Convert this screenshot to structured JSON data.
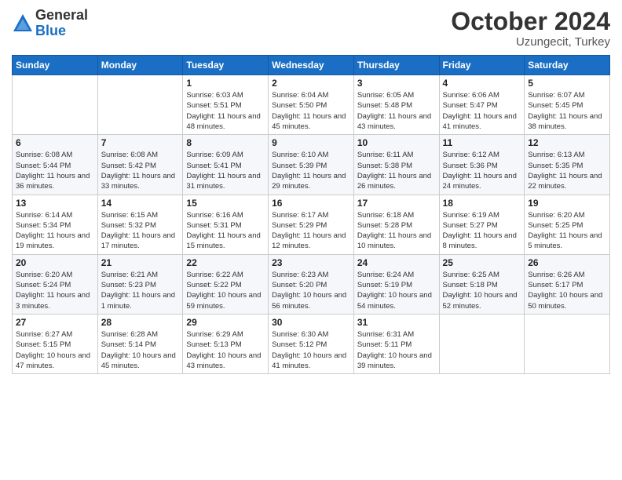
{
  "header": {
    "logo_general": "General",
    "logo_blue": "Blue",
    "month": "October 2024",
    "location": "Uzungecit, Turkey"
  },
  "weekdays": [
    "Sunday",
    "Monday",
    "Tuesday",
    "Wednesday",
    "Thursday",
    "Friday",
    "Saturday"
  ],
  "weeks": [
    [
      {
        "day": "",
        "sunrise": "",
        "sunset": "",
        "daylight": ""
      },
      {
        "day": "",
        "sunrise": "",
        "sunset": "",
        "daylight": ""
      },
      {
        "day": "1",
        "sunrise": "Sunrise: 6:03 AM",
        "sunset": "Sunset: 5:51 PM",
        "daylight": "Daylight: 11 hours and 48 minutes."
      },
      {
        "day": "2",
        "sunrise": "Sunrise: 6:04 AM",
        "sunset": "Sunset: 5:50 PM",
        "daylight": "Daylight: 11 hours and 45 minutes."
      },
      {
        "day": "3",
        "sunrise": "Sunrise: 6:05 AM",
        "sunset": "Sunset: 5:48 PM",
        "daylight": "Daylight: 11 hours and 43 minutes."
      },
      {
        "day": "4",
        "sunrise": "Sunrise: 6:06 AM",
        "sunset": "Sunset: 5:47 PM",
        "daylight": "Daylight: 11 hours and 41 minutes."
      },
      {
        "day": "5",
        "sunrise": "Sunrise: 6:07 AM",
        "sunset": "Sunset: 5:45 PM",
        "daylight": "Daylight: 11 hours and 38 minutes."
      }
    ],
    [
      {
        "day": "6",
        "sunrise": "Sunrise: 6:08 AM",
        "sunset": "Sunset: 5:44 PM",
        "daylight": "Daylight: 11 hours and 36 minutes."
      },
      {
        "day": "7",
        "sunrise": "Sunrise: 6:08 AM",
        "sunset": "Sunset: 5:42 PM",
        "daylight": "Daylight: 11 hours and 33 minutes."
      },
      {
        "day": "8",
        "sunrise": "Sunrise: 6:09 AM",
        "sunset": "Sunset: 5:41 PM",
        "daylight": "Daylight: 11 hours and 31 minutes."
      },
      {
        "day": "9",
        "sunrise": "Sunrise: 6:10 AM",
        "sunset": "Sunset: 5:39 PM",
        "daylight": "Daylight: 11 hours and 29 minutes."
      },
      {
        "day": "10",
        "sunrise": "Sunrise: 6:11 AM",
        "sunset": "Sunset: 5:38 PM",
        "daylight": "Daylight: 11 hours and 26 minutes."
      },
      {
        "day": "11",
        "sunrise": "Sunrise: 6:12 AM",
        "sunset": "Sunset: 5:36 PM",
        "daylight": "Daylight: 11 hours and 24 minutes."
      },
      {
        "day": "12",
        "sunrise": "Sunrise: 6:13 AM",
        "sunset": "Sunset: 5:35 PM",
        "daylight": "Daylight: 11 hours and 22 minutes."
      }
    ],
    [
      {
        "day": "13",
        "sunrise": "Sunrise: 6:14 AM",
        "sunset": "Sunset: 5:34 PM",
        "daylight": "Daylight: 11 hours and 19 minutes."
      },
      {
        "day": "14",
        "sunrise": "Sunrise: 6:15 AM",
        "sunset": "Sunset: 5:32 PM",
        "daylight": "Daylight: 11 hours and 17 minutes."
      },
      {
        "day": "15",
        "sunrise": "Sunrise: 6:16 AM",
        "sunset": "Sunset: 5:31 PM",
        "daylight": "Daylight: 11 hours and 15 minutes."
      },
      {
        "day": "16",
        "sunrise": "Sunrise: 6:17 AM",
        "sunset": "Sunset: 5:29 PM",
        "daylight": "Daylight: 11 hours and 12 minutes."
      },
      {
        "day": "17",
        "sunrise": "Sunrise: 6:18 AM",
        "sunset": "Sunset: 5:28 PM",
        "daylight": "Daylight: 11 hours and 10 minutes."
      },
      {
        "day": "18",
        "sunrise": "Sunrise: 6:19 AM",
        "sunset": "Sunset: 5:27 PM",
        "daylight": "Daylight: 11 hours and 8 minutes."
      },
      {
        "day": "19",
        "sunrise": "Sunrise: 6:20 AM",
        "sunset": "Sunset: 5:25 PM",
        "daylight": "Daylight: 11 hours and 5 minutes."
      }
    ],
    [
      {
        "day": "20",
        "sunrise": "Sunrise: 6:20 AM",
        "sunset": "Sunset: 5:24 PM",
        "daylight": "Daylight: 11 hours and 3 minutes."
      },
      {
        "day": "21",
        "sunrise": "Sunrise: 6:21 AM",
        "sunset": "Sunset: 5:23 PM",
        "daylight": "Daylight: 11 hours and 1 minute."
      },
      {
        "day": "22",
        "sunrise": "Sunrise: 6:22 AM",
        "sunset": "Sunset: 5:22 PM",
        "daylight": "Daylight: 10 hours and 59 minutes."
      },
      {
        "day": "23",
        "sunrise": "Sunrise: 6:23 AM",
        "sunset": "Sunset: 5:20 PM",
        "daylight": "Daylight: 10 hours and 56 minutes."
      },
      {
        "day": "24",
        "sunrise": "Sunrise: 6:24 AM",
        "sunset": "Sunset: 5:19 PM",
        "daylight": "Daylight: 10 hours and 54 minutes."
      },
      {
        "day": "25",
        "sunrise": "Sunrise: 6:25 AM",
        "sunset": "Sunset: 5:18 PM",
        "daylight": "Daylight: 10 hours and 52 minutes."
      },
      {
        "day": "26",
        "sunrise": "Sunrise: 6:26 AM",
        "sunset": "Sunset: 5:17 PM",
        "daylight": "Daylight: 10 hours and 50 minutes."
      }
    ],
    [
      {
        "day": "27",
        "sunrise": "Sunrise: 6:27 AM",
        "sunset": "Sunset: 5:15 PM",
        "daylight": "Daylight: 10 hours and 47 minutes."
      },
      {
        "day": "28",
        "sunrise": "Sunrise: 6:28 AM",
        "sunset": "Sunset: 5:14 PM",
        "daylight": "Daylight: 10 hours and 45 minutes."
      },
      {
        "day": "29",
        "sunrise": "Sunrise: 6:29 AM",
        "sunset": "Sunset: 5:13 PM",
        "daylight": "Daylight: 10 hours and 43 minutes."
      },
      {
        "day": "30",
        "sunrise": "Sunrise: 6:30 AM",
        "sunset": "Sunset: 5:12 PM",
        "daylight": "Daylight: 10 hours and 41 minutes."
      },
      {
        "day": "31",
        "sunrise": "Sunrise: 6:31 AM",
        "sunset": "Sunset: 5:11 PM",
        "daylight": "Daylight: 10 hours and 39 minutes."
      },
      {
        "day": "",
        "sunrise": "",
        "sunset": "",
        "daylight": ""
      },
      {
        "day": "",
        "sunrise": "",
        "sunset": "",
        "daylight": ""
      }
    ]
  ]
}
